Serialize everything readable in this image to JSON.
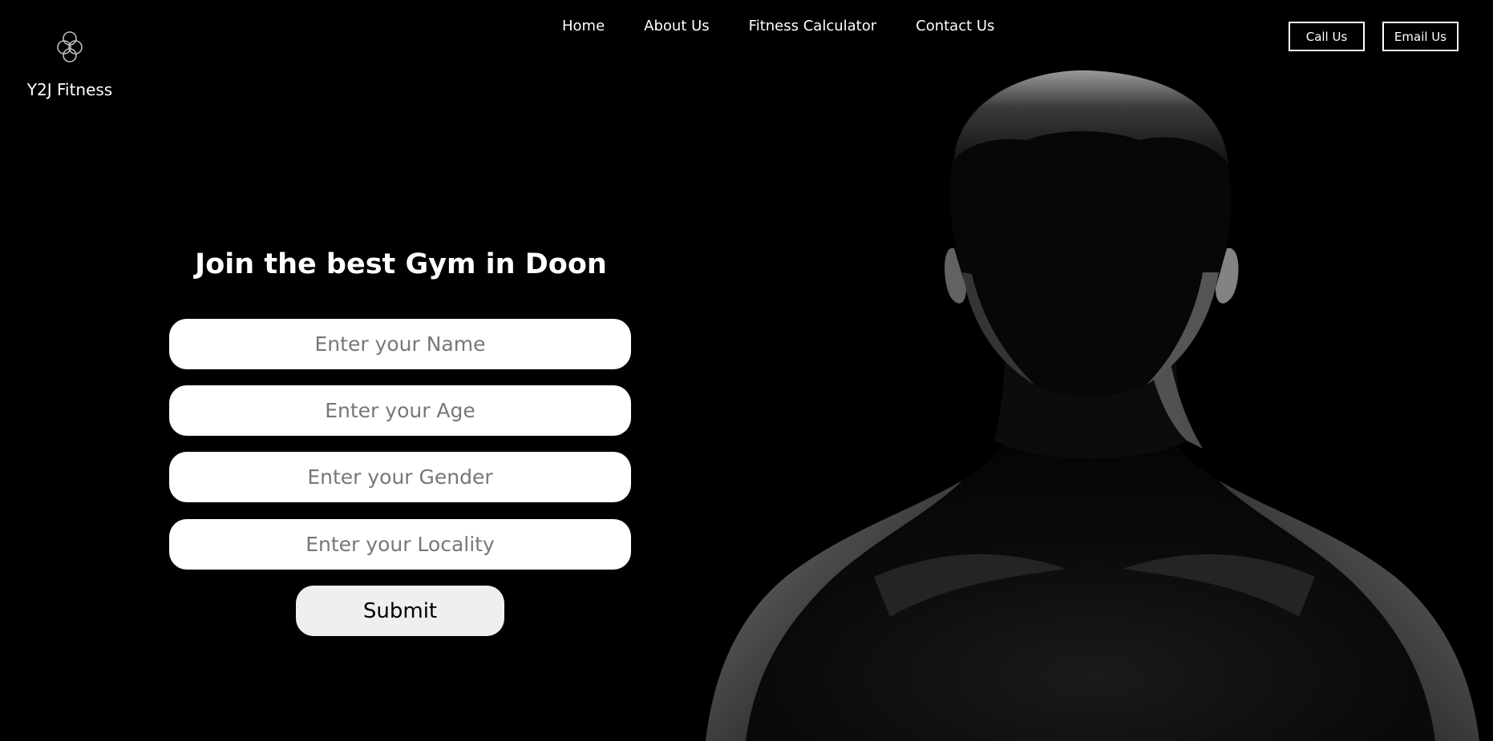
{
  "brand": {
    "name": "Y2J Fitness",
    "logo_icon": "interlocking-rings-icon"
  },
  "nav": {
    "items": [
      {
        "label": "Home"
      },
      {
        "label": "About Us"
      },
      {
        "label": "Fitness Calculator"
      },
      {
        "label": "Contact Us"
      }
    ]
  },
  "header_buttons": {
    "call": "Call Us",
    "email": "Email Us"
  },
  "form": {
    "title": "Join the best Gym in Doon",
    "name_placeholder": "Enter your Name",
    "age_placeholder": "Enter your Age",
    "gender_placeholder": "Enter your Gender",
    "locality_placeholder": "Enter your Locality",
    "submit_label": "Submit"
  },
  "colors": {
    "background": "#000000",
    "text": "#ffffff",
    "field_bg": "#ffffff",
    "submit_bg": "#efefef"
  }
}
